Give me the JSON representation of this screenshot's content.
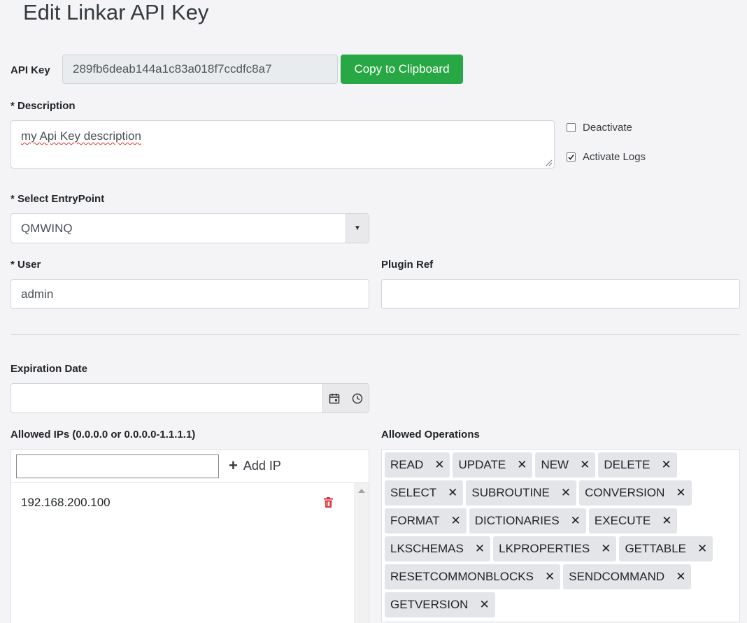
{
  "page": {
    "title": "Edit Linkar API Key"
  },
  "api_key": {
    "label": "API Key",
    "value": "289fb6deab144a1c83a018f7ccdfc8a7",
    "copy_button": "Copy to Clipboard"
  },
  "description": {
    "label": "* Description",
    "value": "my Api Key description"
  },
  "options": {
    "deactivate": "Deactivate",
    "deactivate_checked": false,
    "activate_logs": "Activate Logs",
    "activate_logs_checked": true
  },
  "entrypoint": {
    "label": "* Select EntryPoint",
    "value": "QMWINQ"
  },
  "user": {
    "label": "* User",
    "value": "admin"
  },
  "plugin": {
    "label": "Plugin Ref",
    "value": ""
  },
  "expiration": {
    "label": "Expiration Date",
    "value": ""
  },
  "ips": {
    "label": "Allowed IPs (0.0.0.0 or 0.0.0.0-1.1.1.1)",
    "add_label": "Add IP",
    "items": [
      "192.168.200.100"
    ]
  },
  "operations": {
    "label": "Allowed Operations",
    "items": [
      "READ",
      "UPDATE",
      "NEW",
      "DELETE",
      "SELECT",
      "SUBROUTINE",
      "CONVERSION",
      "FORMAT",
      "DICTIONARIES",
      "EXECUTE",
      "LKSCHEMAS",
      "LKPROPERTIES",
      "GETTABLE",
      "RESETCOMMONBLOCKS",
      "SENDCOMMAND",
      "GETVERSION"
    ]
  },
  "colors": {
    "accent": "#28a745",
    "delete_icon": "#dc3545"
  }
}
